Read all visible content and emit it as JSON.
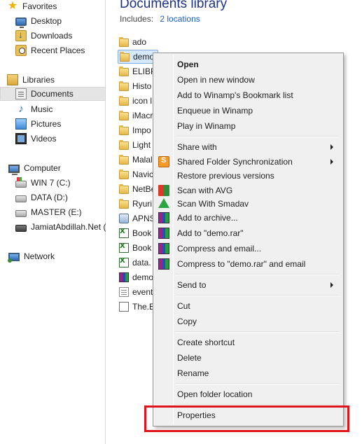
{
  "nav": {
    "favorites": "Favorites",
    "desktop": "Desktop",
    "downloads": "Downloads",
    "recent_places": "Recent Places",
    "libraries": "Libraries",
    "documents": "Documents",
    "music": "Music",
    "pictures": "Pictures",
    "videos": "Videos",
    "computer": "Computer",
    "drives": [
      "WIN 7 (C:)",
      "DATA (D:)",
      "MASTER (E:)",
      "JamiatAbdillah.Net ("
    ],
    "network": "Network"
  },
  "library": {
    "title": "Documents library",
    "includes_label": "Includes:",
    "locations_link": "2 locations"
  },
  "files": [
    {
      "name": "ado",
      "icon": "folder-icon"
    },
    {
      "name": "demo",
      "icon": "folder-icon"
    },
    {
      "name": "ELIBR",
      "icon": "folder-icon"
    },
    {
      "name": "Histo",
      "icon": "folder-icon"
    },
    {
      "name": "icon l",
      "icon": "folder-icon"
    },
    {
      "name": "iMacr",
      "icon": "folder-icon"
    },
    {
      "name": "Impo",
      "icon": "folder-icon"
    },
    {
      "name": "Light",
      "icon": "folder-icon"
    },
    {
      "name": "Malal",
      "icon": "folder-icon"
    },
    {
      "name": "Navic",
      "icon": "folder-icon"
    },
    {
      "name": "NetBe",
      "icon": "folder-icon"
    },
    {
      "name": "Ryuri",
      "icon": "folder-icon"
    },
    {
      "name": "APNS",
      "icon": "apns-icon"
    },
    {
      "name": "Book",
      "icon": "excel-icon"
    },
    {
      "name": "Book",
      "icon": "excel-icon"
    },
    {
      "name": "data.",
      "icon": "excel-icon"
    },
    {
      "name": "demo",
      "icon": "rar-icon"
    },
    {
      "name": "event",
      "icon": "text-file-icon"
    },
    {
      "name": "The.E",
      "icon": "document-icon"
    }
  ],
  "context_menu": {
    "open": "Open",
    "open_new_window": "Open in new window",
    "add_winamp_bookmark": "Add to Winamp's Bookmark list",
    "enqueue_winamp": "Enqueue in Winamp",
    "play_winamp": "Play in Winamp",
    "share_with": "Share with",
    "shared_folder_sync": "Shared Folder Synchronization",
    "restore_versions": "Restore previous versions",
    "scan_avg": "Scan with AVG",
    "scan_smadav": "Scan With Smadav",
    "add_archive": "Add to archive...",
    "add_demo_rar": "Add to \"demo.rar\"",
    "compress_email": "Compress and email...",
    "compress_demo_rar_email": "Compress to \"demo.rar\" and email",
    "send_to": "Send to",
    "cut": "Cut",
    "copy": "Copy",
    "create_shortcut": "Create shortcut",
    "delete": "Delete",
    "rename": "Rename",
    "open_folder_location": "Open folder location",
    "properties": "Properties"
  },
  "colors": {
    "highlight_box": "#e0141b",
    "title": "#1e3287",
    "link": "#1c5ec5"
  }
}
